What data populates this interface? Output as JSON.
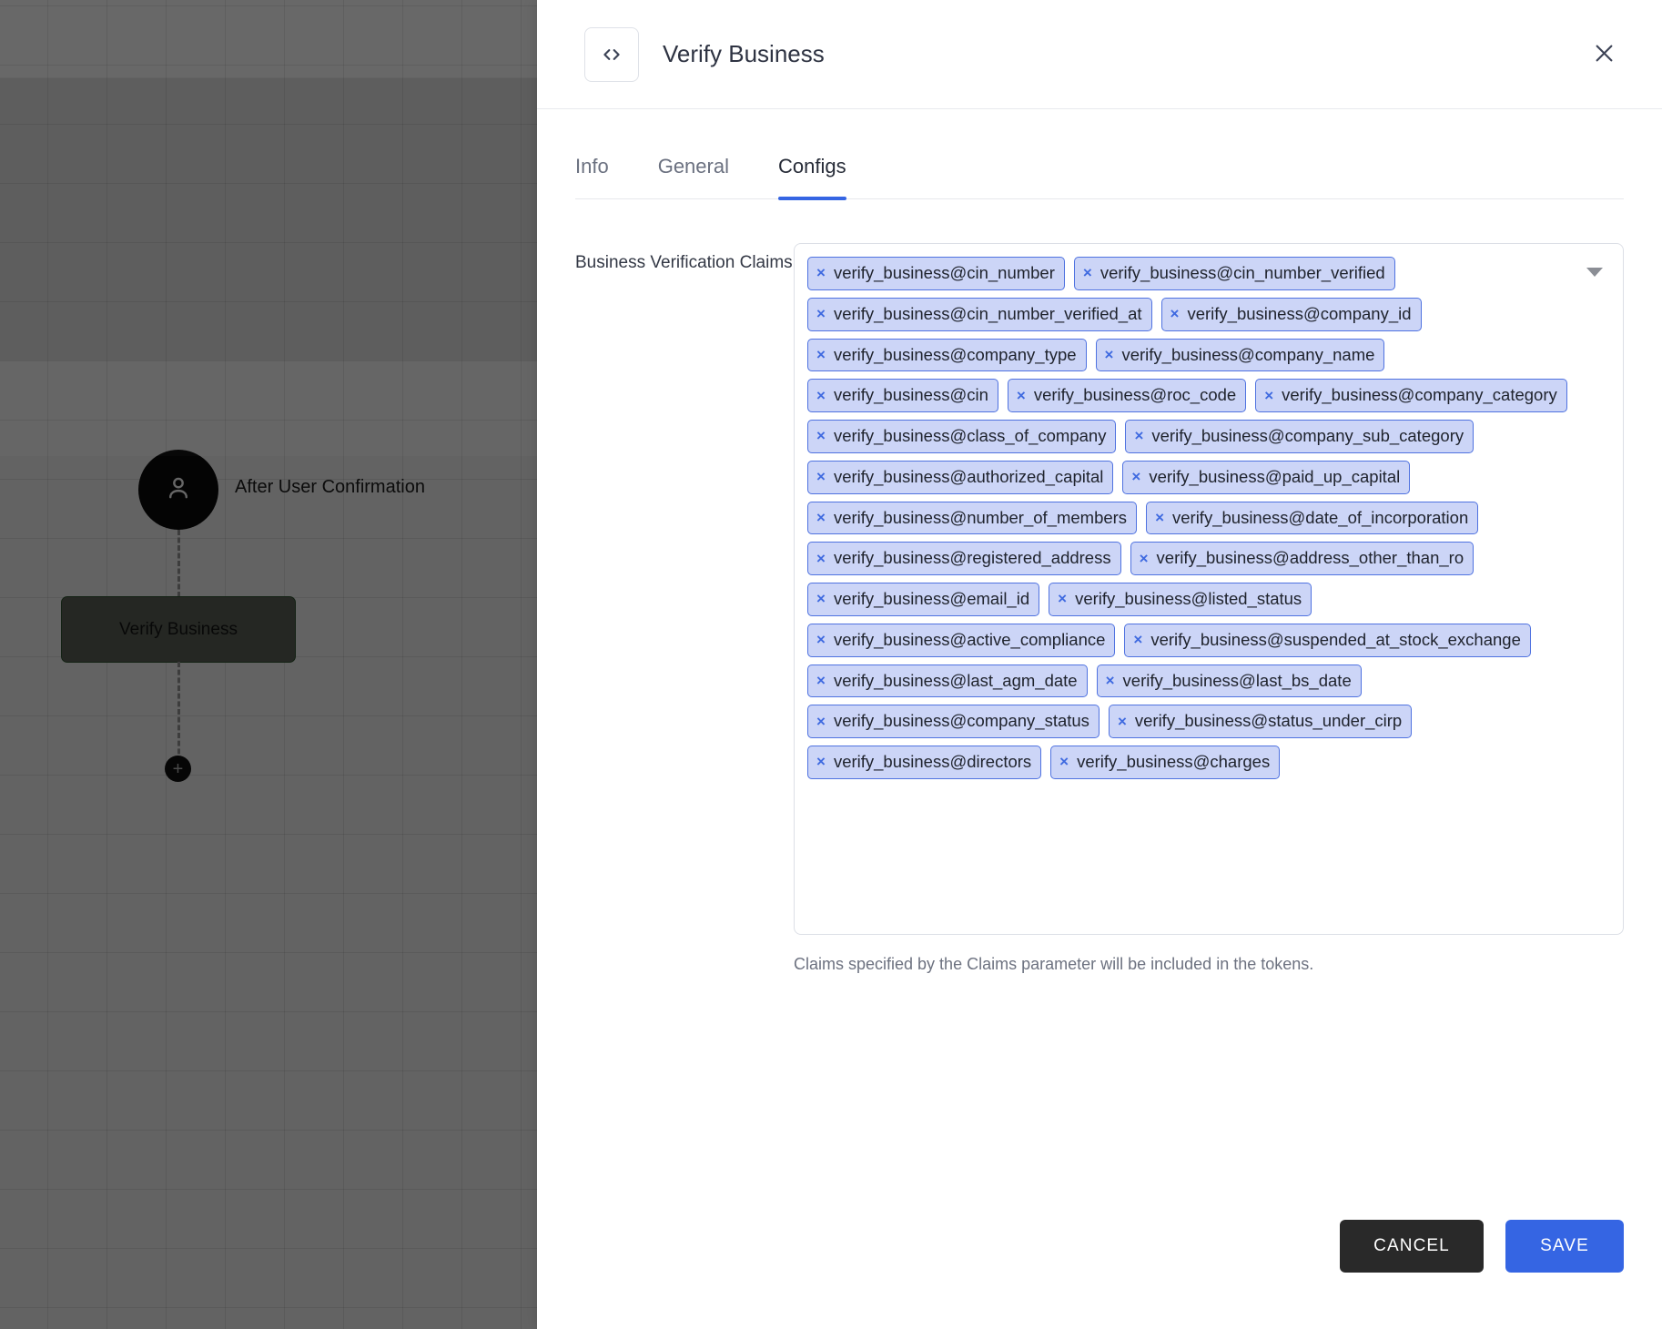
{
  "canvas": {
    "start_node": {
      "icon": "user-icon",
      "label": "After User Confirmation"
    },
    "task_node": {
      "label": "Verify Business"
    },
    "add_handle": {
      "icon": "plus-icon",
      "label": "+"
    }
  },
  "panel": {
    "header": {
      "icon": "code-brackets-icon",
      "icon_glyph": "<>",
      "title": "Verify Business",
      "close_icon": "close-icon"
    },
    "tabs": [
      {
        "label": "Info",
        "active": false
      },
      {
        "label": "General",
        "active": false
      },
      {
        "label": "Configs",
        "active": true
      }
    ],
    "form": {
      "field_label": "Business Verification Claims",
      "dropdown_icon": "chevron-down-icon",
      "chip_remove_icon": "close-icon",
      "chip_remove_glyph": "×",
      "chips": [
        "verify_business@cin_number",
        "verify_business@cin_number_verified",
        "verify_business@cin_number_verified_at",
        "verify_business@company_id",
        "verify_business@company_type",
        "verify_business@company_name",
        "verify_business@cin",
        "verify_business@roc_code",
        "verify_business@company_category",
        "verify_business@class_of_company",
        "verify_business@company_sub_category",
        "verify_business@authorized_capital",
        "verify_business@paid_up_capital",
        "verify_business@number_of_members",
        "verify_business@date_of_incorporation",
        "verify_business@registered_address",
        "verify_business@address_other_than_ro",
        "verify_business@email_id",
        "verify_business@listed_status",
        "verify_business@active_compliance",
        "verify_business@suspended_at_stock_exchange",
        "verify_business@last_agm_date",
        "verify_business@last_bs_date",
        "verify_business@company_status",
        "verify_business@status_under_cirp",
        "verify_business@directors",
        "verify_business@charges"
      ],
      "helper_text": "Claims specified by the Claims parameter will be included in the tokens."
    },
    "footer": {
      "cancel_label": "CANCEL",
      "save_label": "SAVE"
    }
  },
  "colors": {
    "accent_blue": "#3565e3",
    "chip_bg": "#ccd5f7",
    "chip_border": "#4f72e0",
    "cancel_bg": "#292929",
    "node_fill": "#5c6357",
    "node_border": "#2f5430"
  }
}
